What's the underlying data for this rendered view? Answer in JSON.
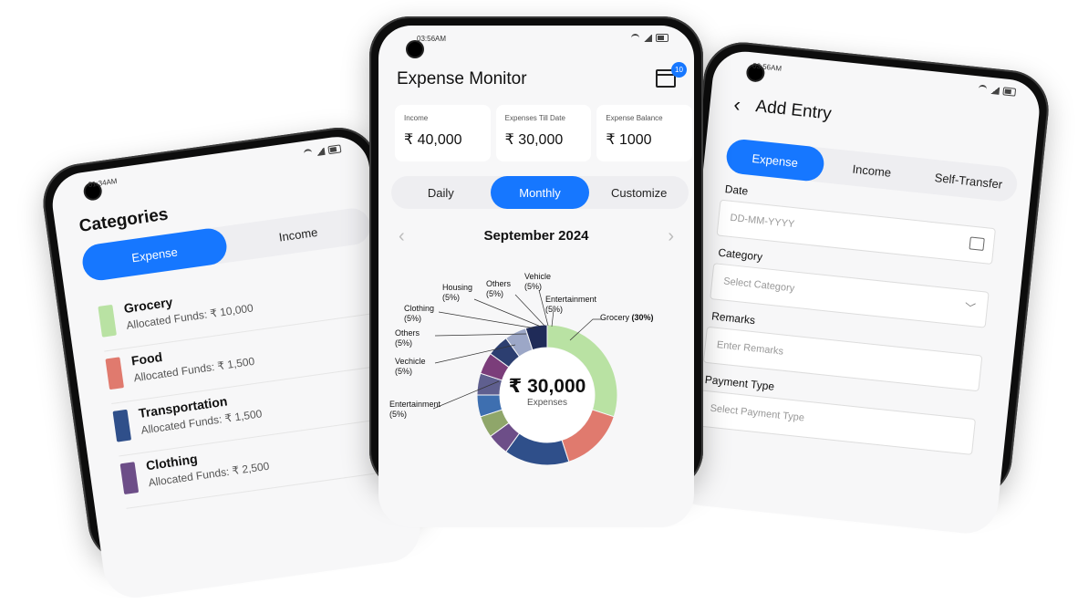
{
  "left_phone": {
    "status_time": "01:34AM",
    "title": "Categories",
    "tabs": [
      {
        "label": "Expense",
        "active": true
      },
      {
        "label": "Income",
        "active": false
      }
    ],
    "categories": [
      {
        "name": "Grocery",
        "funds": "Allocated Funds: ₹ 10,000",
        "color": "#b9e2a3"
      },
      {
        "name": "Food",
        "funds": "Allocated Funds: ₹ 1,500",
        "color": "#e07a6e"
      },
      {
        "name": "Transportation",
        "funds": "Allocated Funds: ₹ 1,500",
        "color": "#2f4f8a"
      },
      {
        "name": "Clothing",
        "funds": "Allocated Funds: ₹ 2,500",
        "color": "#6d4e88"
      }
    ]
  },
  "center_phone": {
    "status_time": "03:56AM",
    "title": "Expense Monitor",
    "badge_count": "10",
    "cards": [
      {
        "label": "Income",
        "value": "₹ 40,000"
      },
      {
        "label": "Expenses Till Date",
        "value": "₹ 30,000"
      },
      {
        "label": "Expense Balance",
        "value": "₹ 1000"
      }
    ],
    "tabs": [
      {
        "label": "Daily",
        "active": false
      },
      {
        "label": "Monthly",
        "active": true
      },
      {
        "label": "Customize",
        "active": false
      }
    ],
    "month": "September 2024",
    "total": "₹ 30,000",
    "total_label": "Expenses",
    "chart_data": {
      "type": "pie",
      "categories": [
        "Grocery",
        "Food",
        "Transportation",
        "Entertainment",
        "Vechicle",
        "Others",
        "Clothing",
        "Housing",
        "Others",
        "Vehicle",
        "Entertainment"
      ],
      "values": [
        30,
        15,
        15,
        5,
        5,
        5,
        5,
        5,
        5,
        5,
        5
      ],
      "colors": [
        "#b9e2a3",
        "#e07a6e",
        "#2f4f8a",
        "#6d4e88",
        "#8fa66a",
        "#3e6fb0",
        "#5f5f8f",
        "#7b3d7a",
        "#2c3e70",
        "#9ca7c7",
        "#1f2b58"
      ],
      "labels": [
        {
          "name": "Grocery",
          "pct": "(30%)"
        },
        {
          "name": "Entertainment",
          "pct": "(5%)"
        },
        {
          "name": "Vehicle",
          "pct": "(5%)"
        },
        {
          "name": "Others",
          "pct": "(5%)"
        },
        {
          "name": "Housing",
          "pct": "(5%)"
        },
        {
          "name": "Clothing",
          "pct": "(5%)"
        },
        {
          "name": "Others",
          "pct": "(5%)"
        },
        {
          "name": "Vechicle",
          "pct": "(5%)"
        },
        {
          "name": "Entertainment",
          "pct": "(5%)"
        }
      ]
    }
  },
  "right_phone": {
    "status_time": "03:56AM",
    "title": "Add Entry",
    "tabs": [
      {
        "label": "Expense",
        "active": true
      },
      {
        "label": "Income",
        "active": false
      },
      {
        "label": "Self-Transfer",
        "active": false
      }
    ],
    "fields": [
      {
        "label": "Date",
        "placeholder": "DD-MM-YYYY"
      },
      {
        "label": "Category",
        "placeholder": "Select Category"
      },
      {
        "label": "Remarks",
        "placeholder": "Enter Remarks"
      },
      {
        "label": "Payment Type",
        "placeholder": "Select Payment Type"
      }
    ]
  }
}
